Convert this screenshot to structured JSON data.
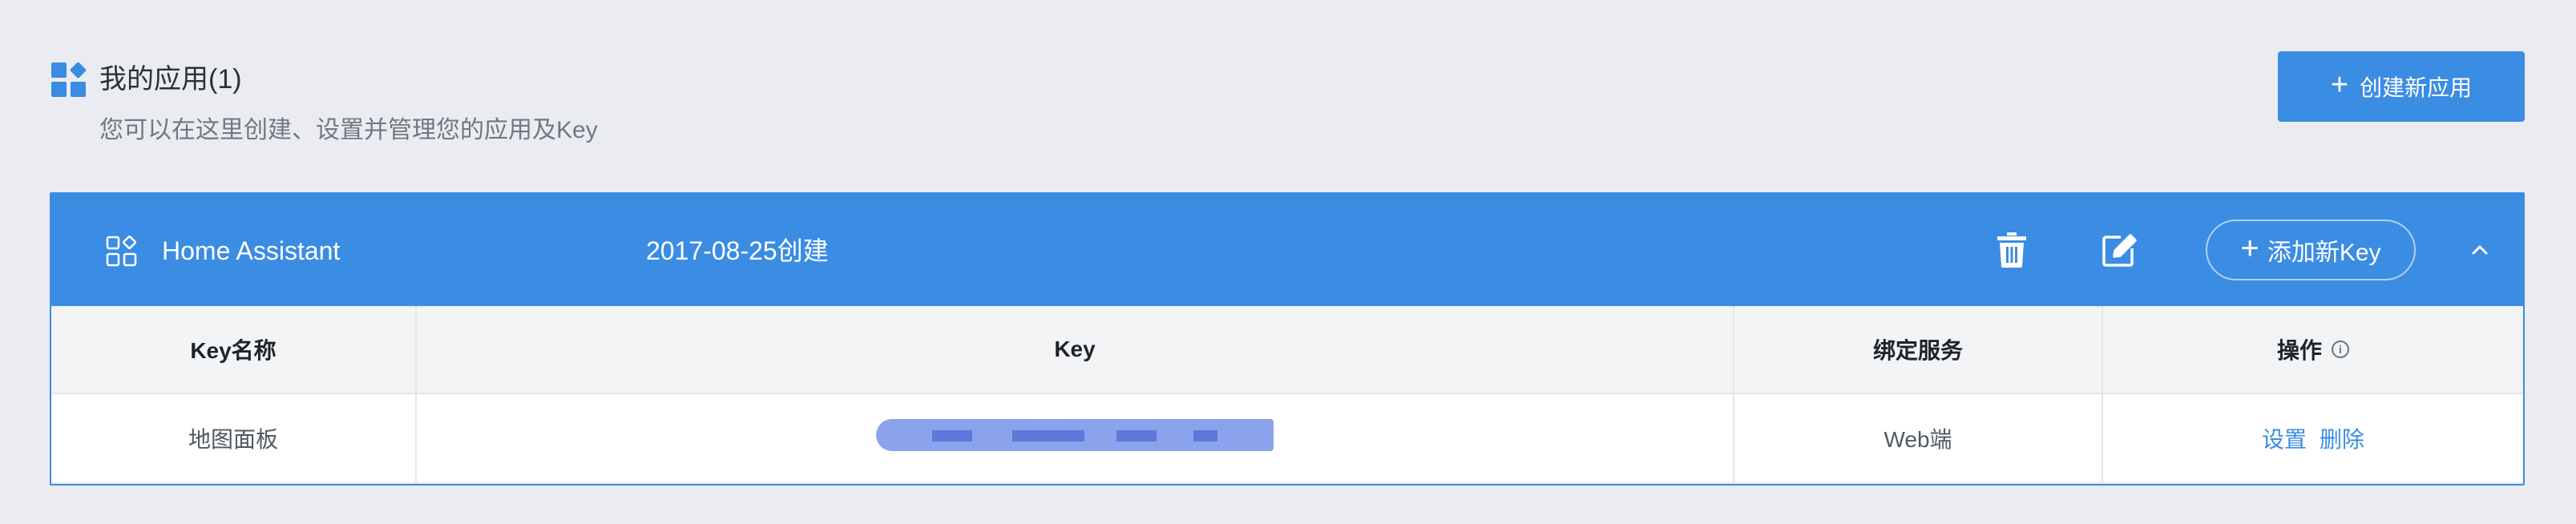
{
  "page": {
    "title": "我的应用(1)",
    "subtitle": "您可以在这里创建、设置并管理您的应用及Key",
    "create_button_label": "创建新应用"
  },
  "app": {
    "name": "Home Assistant",
    "created": "2017-08-25创建",
    "add_key_label": "添加新Key",
    "icons": {
      "delete": "trash-icon",
      "edit": "edit-icon",
      "collapse": "chevron-up-icon",
      "app": "apps-icon"
    }
  },
  "table": {
    "headers": [
      "Key名称",
      "Key",
      "绑定服务",
      "操作"
    ],
    "rows": [
      {
        "name": "地图面板",
        "key": "",
        "service": "Web端",
        "actions": [
          "设置",
          "删除"
        ]
      }
    ]
  },
  "colors": {
    "accent": "#3b8ce3",
    "background": "#ebecf1",
    "masked_key": "#8aa3ec"
  }
}
